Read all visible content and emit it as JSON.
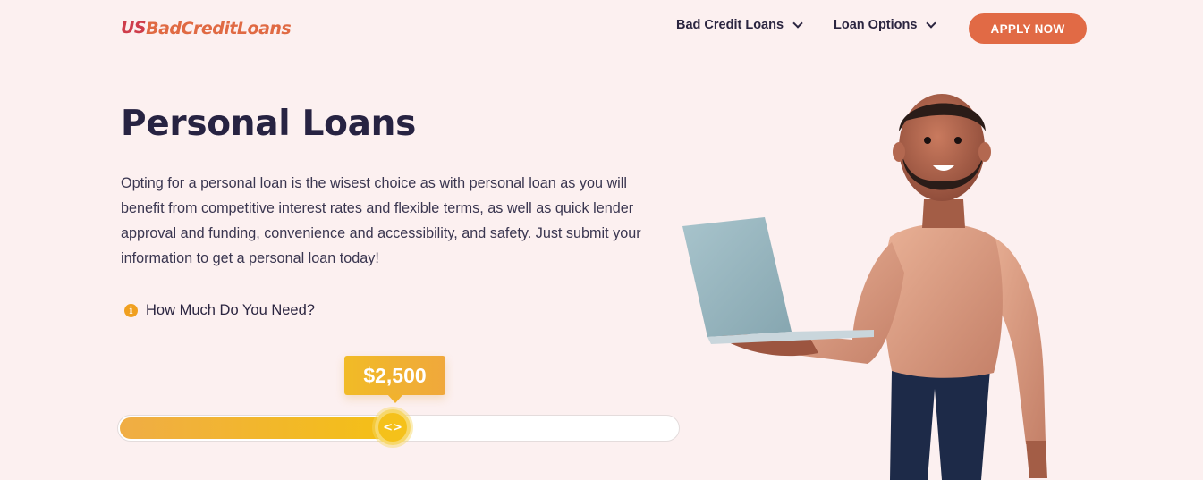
{
  "header": {
    "logo_us": "US",
    "logo_rest": "BadCreditLoans",
    "nav": [
      {
        "label": "Bad Credit Loans"
      },
      {
        "label": "Loan Options"
      }
    ],
    "apply_label": "APPLY NOW"
  },
  "hero": {
    "title": "Personal Loans",
    "intro": "Opting for a personal loan is the wisest choice as with personal loan as you will benefit from competitive interest rates and flexible terms, as well as quick lender approval and funding, convenience and accessibility, and safety. Just submit your information to get a personal loan today!",
    "need_label": "How Much Do You Need?"
  },
  "slider": {
    "value_label": "$2,500",
    "fill_fraction": 0.49,
    "thumb_icon": "code-arrows-icon"
  },
  "colors": {
    "accent": "#e16a45",
    "slider_yellow": "#f4c015",
    "background": "#fcf0f0",
    "heading": "#272342"
  },
  "icons": {
    "info": "info-circle-icon",
    "chevron": "chevron-down-icon"
  }
}
